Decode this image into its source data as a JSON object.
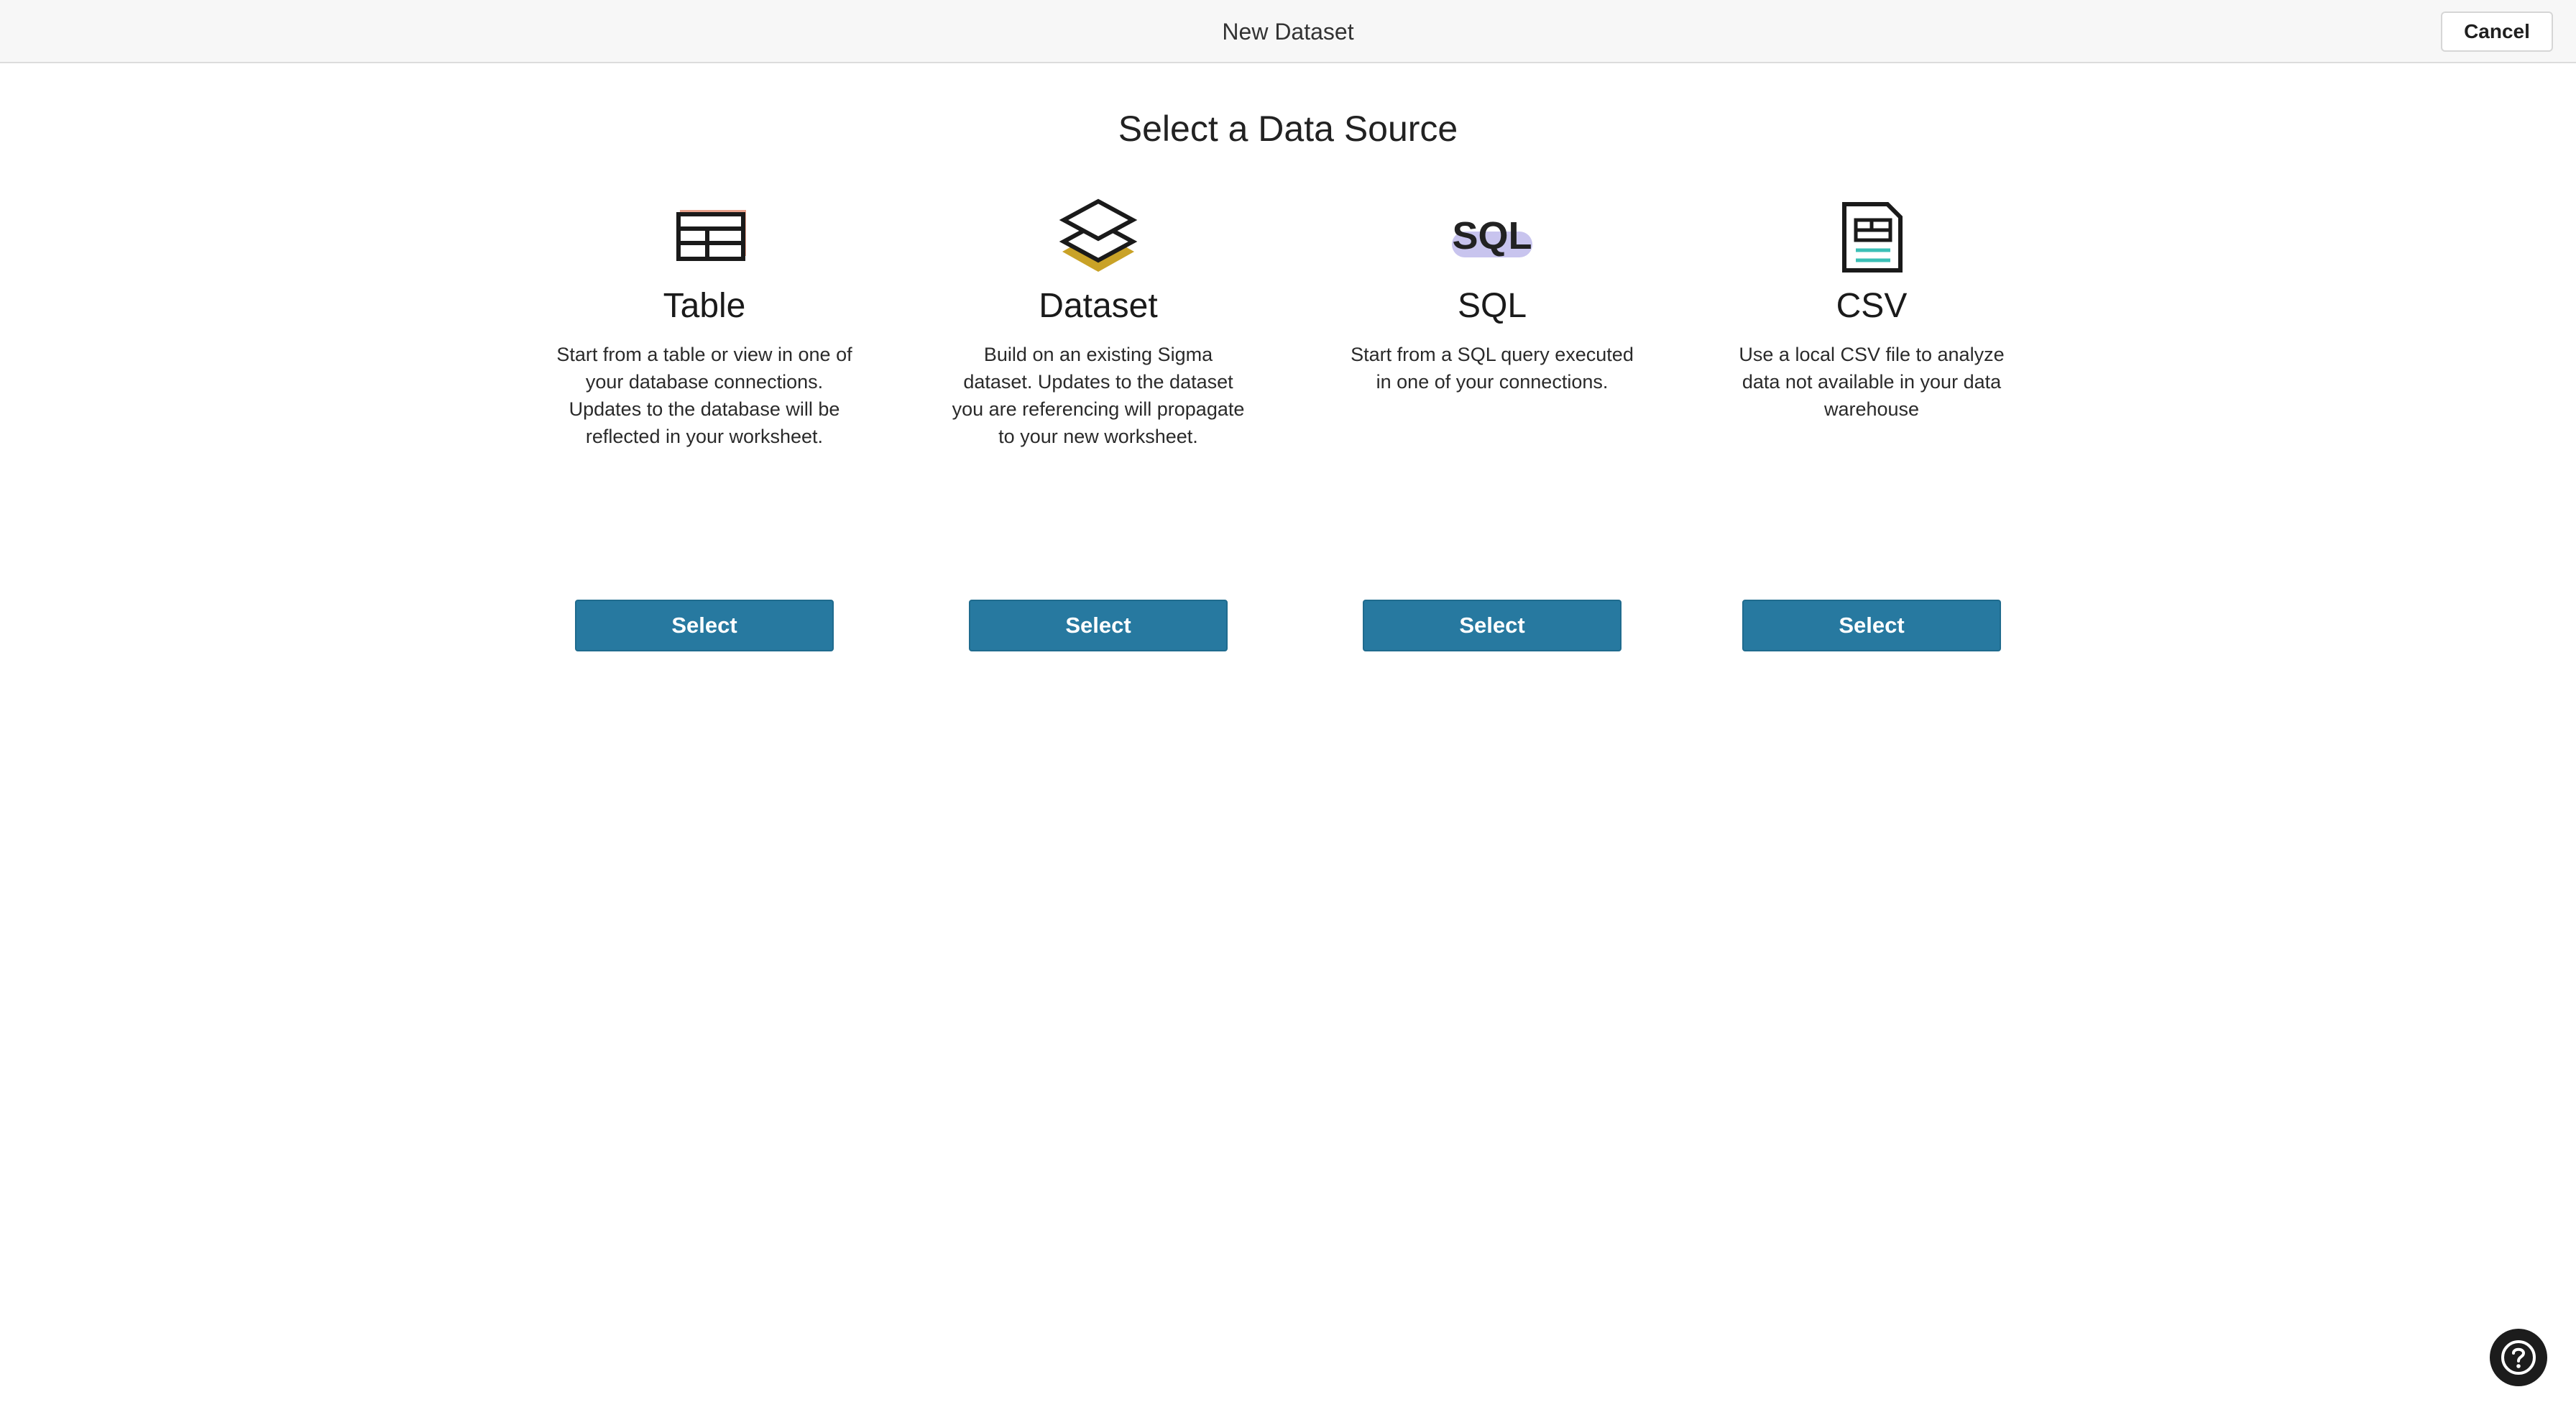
{
  "header": {
    "title": "New Dataset",
    "cancel_label": "Cancel"
  },
  "main": {
    "heading": "Select a Data Source",
    "cards": [
      {
        "icon": "table-icon",
        "title": "Table",
        "description": "Start from a table or view in one of your database connections. Updates to the database will be reflected in your worksheet.",
        "button_label": "Select"
      },
      {
        "icon": "dataset-layers-icon",
        "title": "Dataset",
        "description": "Build on an existing Sigma dataset. Updates to the dataset you are referencing will propagate to your new worksheet.",
        "button_label": "Select"
      },
      {
        "icon": "sql-icon",
        "icon_text": "SQL",
        "title": "SQL",
        "description": "Start from a SQL query executed in one of your connections.",
        "button_label": "Select"
      },
      {
        "icon": "csv-file-icon",
        "title": "CSV",
        "description": "Use a local CSV file to analyze data not available in your data warehouse",
        "button_label": "Select"
      }
    ]
  },
  "help": {
    "icon": "help-icon"
  },
  "colors": {
    "accent": "#2779a0",
    "table_icon_accent": "#e8a08a",
    "dataset_icon_accent": "#c9a227",
    "sql_icon_accent": "#c8c4ee",
    "csv_icon_accent": "#3bbfb6"
  }
}
